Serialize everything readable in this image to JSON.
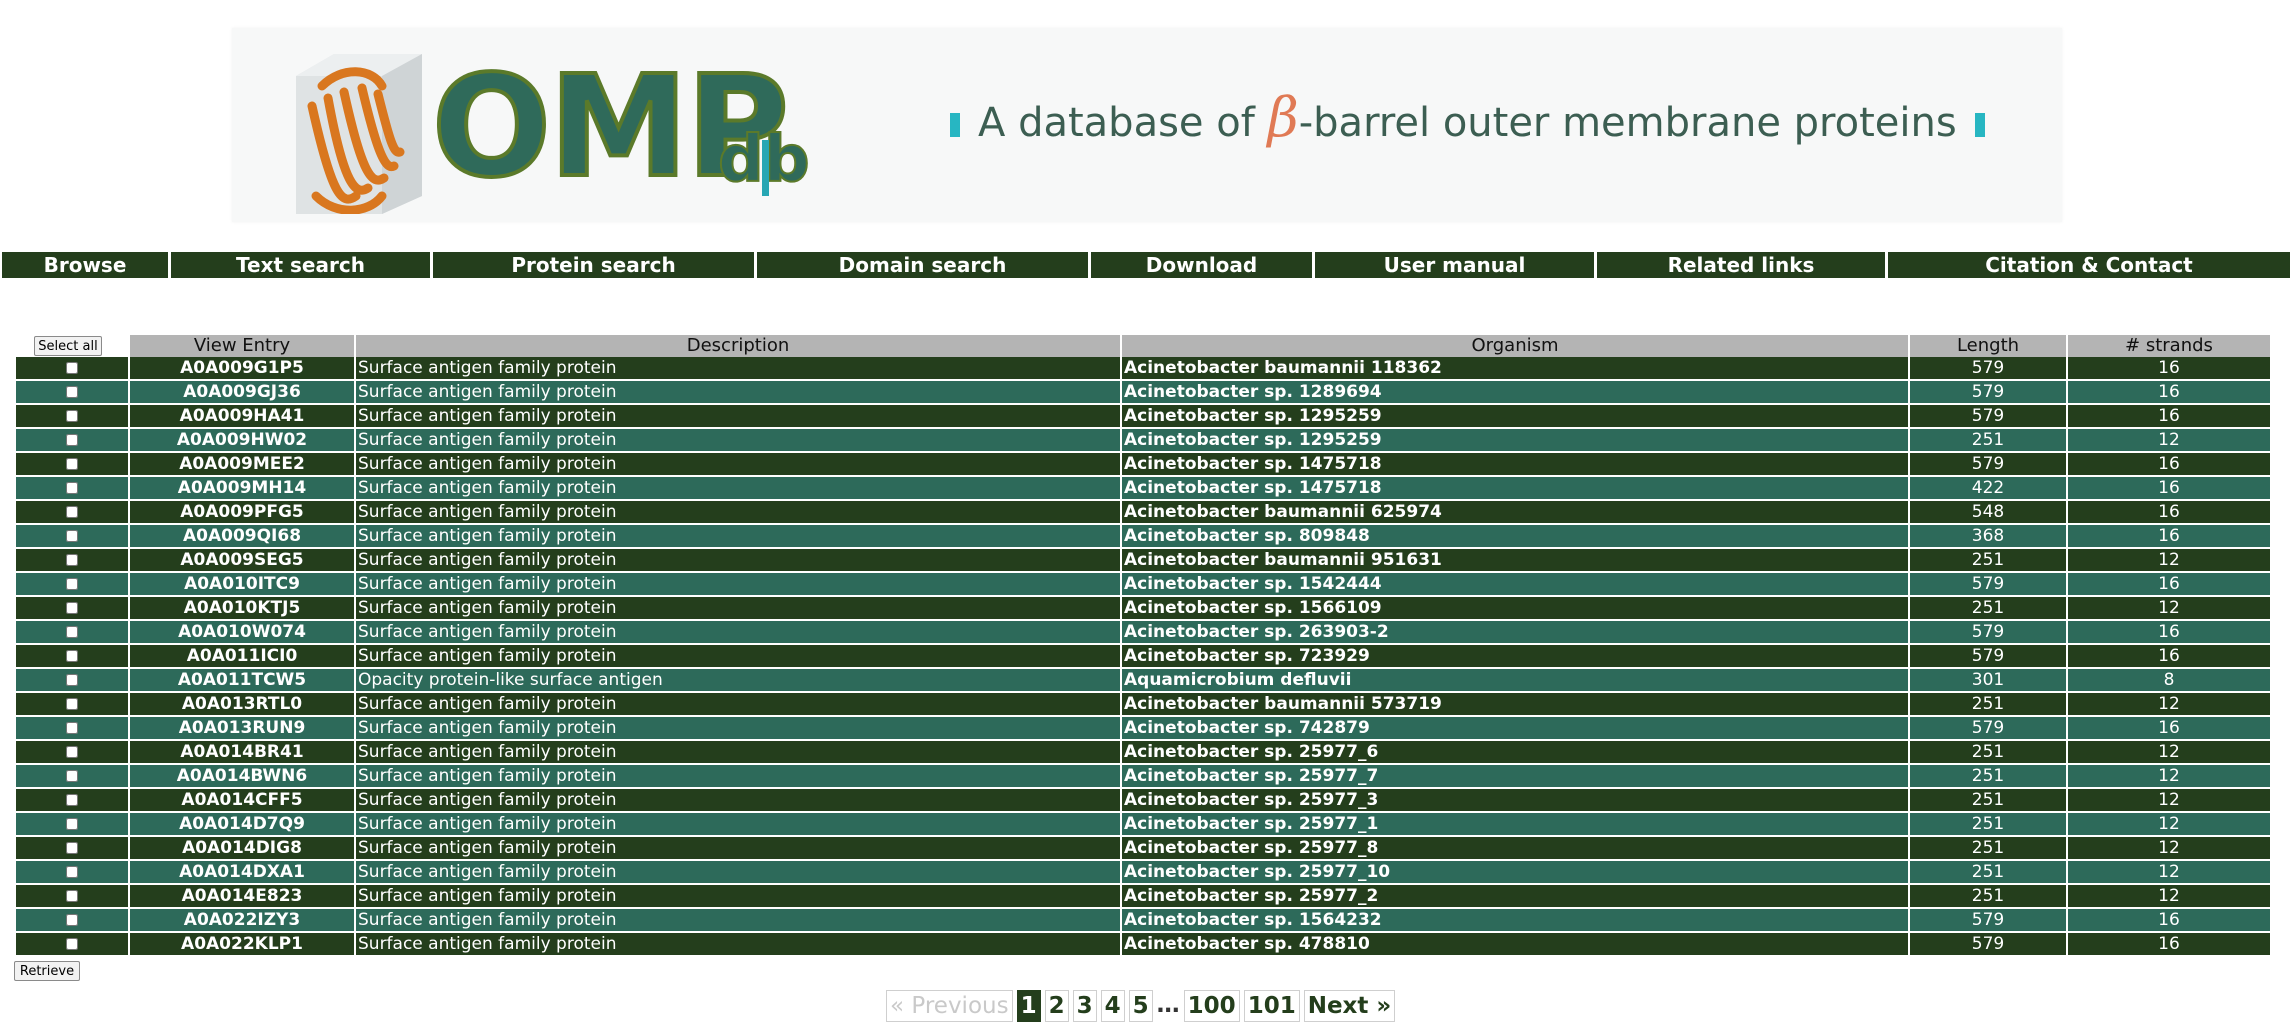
{
  "banner": {
    "logo_text": "OMP",
    "logo_suffix": "db",
    "tagline_pre": "A database of ",
    "tagline_beta": "β",
    "tagline_post": "-barrel outer membrane proteins"
  },
  "nav": [
    {
      "label": "Browse"
    },
    {
      "label": "Text search"
    },
    {
      "label": "Protein search"
    },
    {
      "label": "Domain search"
    },
    {
      "label": "Download"
    },
    {
      "label": "User manual"
    },
    {
      "label": "Related links"
    },
    {
      "label": "Citation & Contact"
    }
  ],
  "table": {
    "select_all_label": "Select all",
    "retrieve_label": "Retrieve",
    "headers": [
      "View Entry",
      "Description",
      "Organism",
      "Length",
      "# strands"
    ],
    "rows": [
      [
        "A0A009G1P5",
        "Surface antigen family protein",
        "Acinetobacter baumannii 118362",
        "579",
        "16"
      ],
      [
        "A0A009GJ36",
        "Surface antigen family protein",
        "Acinetobacter sp. 1289694",
        "579",
        "16"
      ],
      [
        "A0A009HA41",
        "Surface antigen family protein",
        "Acinetobacter sp. 1295259",
        "579",
        "16"
      ],
      [
        "A0A009HW02",
        "Surface antigen family protein",
        "Acinetobacter sp. 1295259",
        "251",
        "12"
      ],
      [
        "A0A009MEE2",
        "Surface antigen family protein",
        "Acinetobacter sp. 1475718",
        "579",
        "16"
      ],
      [
        "A0A009MH14",
        "Surface antigen family protein",
        "Acinetobacter sp. 1475718",
        "422",
        "16"
      ],
      [
        "A0A009PFG5",
        "Surface antigen family protein",
        "Acinetobacter baumannii 625974",
        "548",
        "16"
      ],
      [
        "A0A009QI68",
        "Surface antigen family protein",
        "Acinetobacter sp. 809848",
        "368",
        "16"
      ],
      [
        "A0A009SEG5",
        "Surface antigen family protein",
        "Acinetobacter baumannii 951631",
        "251",
        "12"
      ],
      [
        "A0A010ITC9",
        "Surface antigen family protein",
        "Acinetobacter sp. 1542444",
        "579",
        "16"
      ],
      [
        "A0A010KTJ5",
        "Surface antigen family protein",
        "Acinetobacter sp. 1566109",
        "251",
        "12"
      ],
      [
        "A0A010W074",
        "Surface antigen family protein",
        "Acinetobacter sp. 263903-2",
        "579",
        "16"
      ],
      [
        "A0A011ICI0",
        "Surface antigen family protein",
        "Acinetobacter sp. 723929",
        "579",
        "16"
      ],
      [
        "A0A011TCW5",
        "Opacity protein-like surface antigen",
        "Aquamicrobium defluvii",
        "301",
        "8"
      ],
      [
        "A0A013RTL0",
        "Surface antigen family protein",
        "Acinetobacter baumannii 573719",
        "251",
        "12"
      ],
      [
        "A0A013RUN9",
        "Surface antigen family protein",
        "Acinetobacter sp. 742879",
        "579",
        "16"
      ],
      [
        "A0A014BR41",
        "Surface antigen family protein",
        "Acinetobacter sp. 25977_6",
        "251",
        "12"
      ],
      [
        "A0A014BWN6",
        "Surface antigen family protein",
        "Acinetobacter sp. 25977_7",
        "251",
        "12"
      ],
      [
        "A0A014CFF5",
        "Surface antigen family protein",
        "Acinetobacter sp. 25977_3",
        "251",
        "12"
      ],
      [
        "A0A014D7Q9",
        "Surface antigen family protein",
        "Acinetobacter sp. 25977_1",
        "251",
        "12"
      ],
      [
        "A0A014DIG8",
        "Surface antigen family protein",
        "Acinetobacter sp. 25977_8",
        "251",
        "12"
      ],
      [
        "A0A014DXA1",
        "Surface antigen family protein",
        "Acinetobacter sp. 25977_10",
        "251",
        "12"
      ],
      [
        "A0A014E823",
        "Surface antigen family protein",
        "Acinetobacter sp. 25977_2",
        "251",
        "12"
      ],
      [
        "A0A022IZY3",
        "Surface antigen family protein",
        "Acinetobacter sp. 1564232",
        "579",
        "16"
      ],
      [
        "A0A022KLP1",
        "Surface antigen family protein",
        "Acinetobacter sp. 478810",
        "579",
        "16"
      ]
    ]
  },
  "pagination": {
    "previous_label": "« Previous",
    "pages": [
      "1",
      "2",
      "3",
      "4",
      "5"
    ],
    "ellipsis": "…",
    "tail_pages": [
      "100",
      "101"
    ],
    "next_label": "Next »",
    "current_page": "1"
  },
  "colors": {
    "dark_row": "#243e1c",
    "teal_row": "#2d6a5a",
    "header_grey": "#b4b4b4",
    "accent_cyan": "#27b6c2"
  }
}
